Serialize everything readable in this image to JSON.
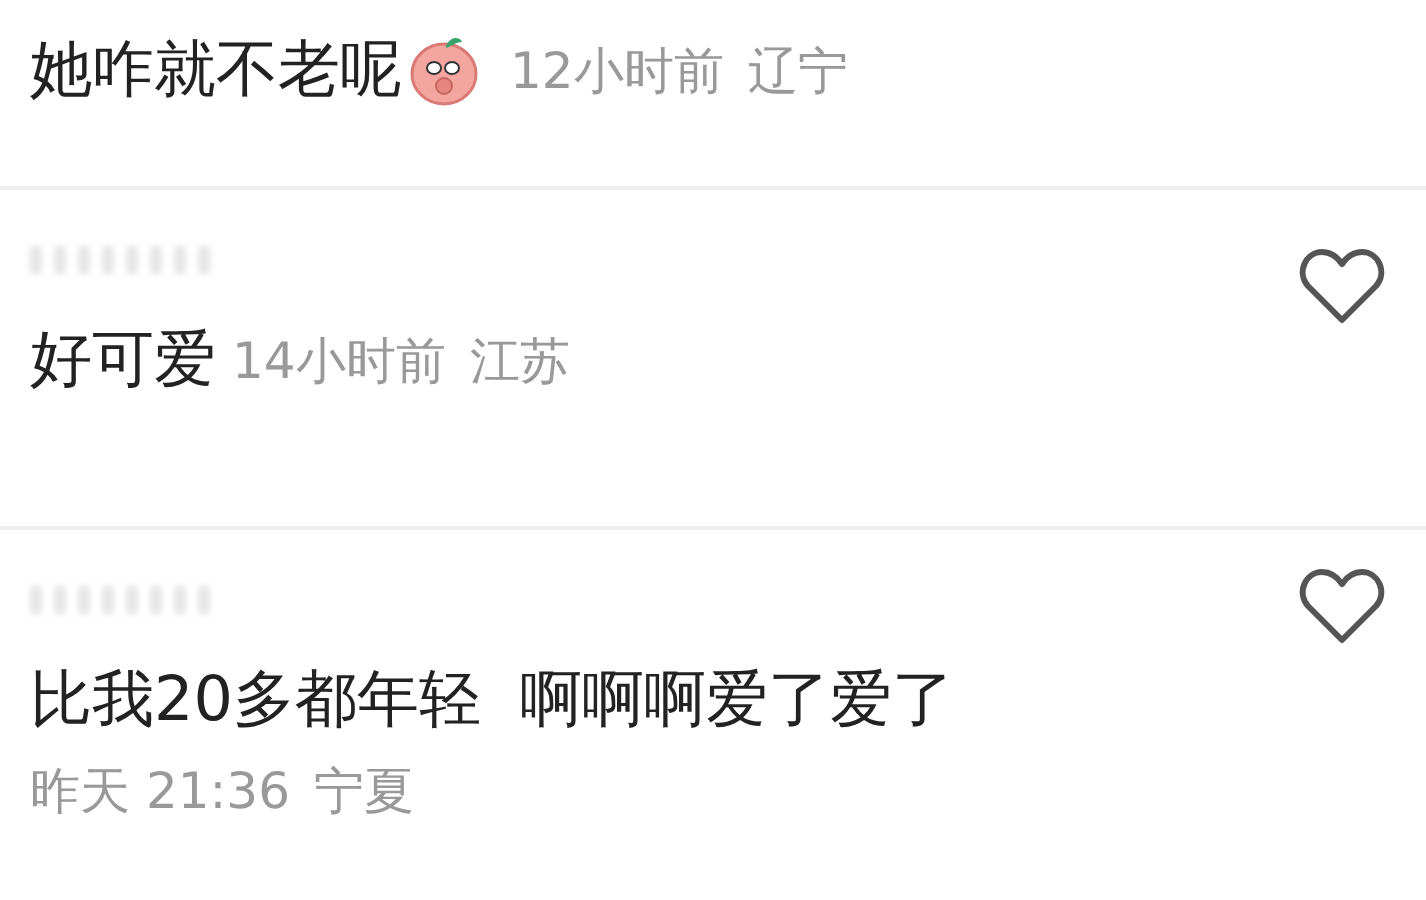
{
  "comments": [
    {
      "kind": "inline",
      "name_hidden": false,
      "emoji": true,
      "like_button": false,
      "text": "她咋就不老呢",
      "time": "12小时前",
      "region": "辽宁"
    },
    {
      "kind": "inline",
      "name_hidden": true,
      "emoji": false,
      "like_button": true,
      "text": "好可爱",
      "time": "14小时前",
      "region": "江苏"
    },
    {
      "kind": "stacked",
      "name_hidden": true,
      "emoji": false,
      "like_button": true,
      "text": "比我20多都年轻  啊啊啊爱了爱了",
      "time": "昨天 21:36",
      "region": "宁夏"
    }
  ]
}
